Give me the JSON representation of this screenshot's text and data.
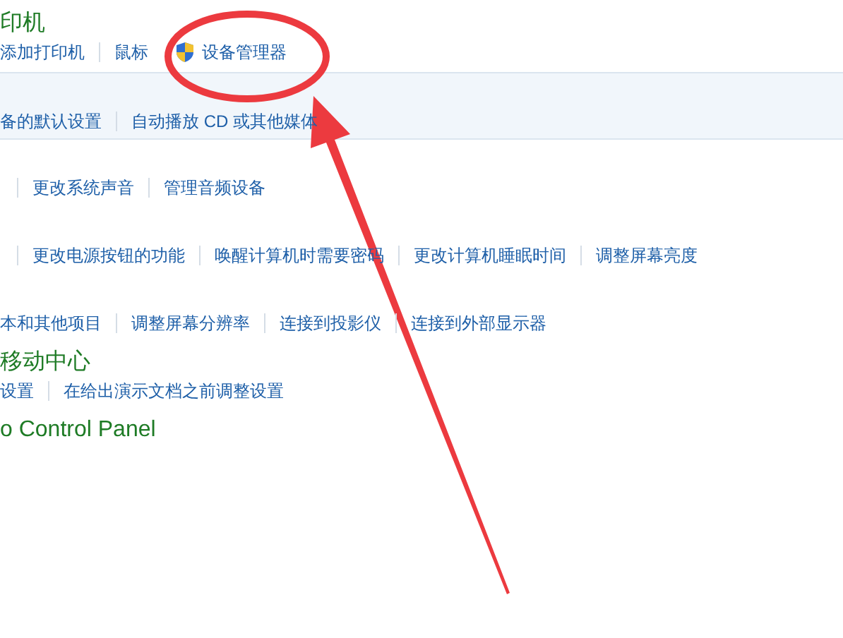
{
  "sections": [
    {
      "title": "印机",
      "highlighted": false,
      "leading_divider": false,
      "links": [
        {
          "label": "添加打印机",
          "shield": false
        },
        {
          "label": "鼠标",
          "shield": false
        },
        {
          "label": "设备管理器",
          "shield": true
        }
      ]
    },
    {
      "highlighted": true,
      "leading_divider": false,
      "links": [
        {
          "label": "备的默认设置",
          "shield": false
        },
        {
          "label": "自动播放 CD 或其他媒体",
          "shield": false
        }
      ]
    },
    {
      "highlighted": false,
      "leading_divider": true,
      "links": [
        {
          "label": "更改系统声音",
          "shield": false
        },
        {
          "label": "管理音频设备",
          "shield": false
        }
      ]
    },
    {
      "highlighted": false,
      "leading_divider": true,
      "links": [
        {
          "label": "更改电源按钮的功能",
          "shield": false
        },
        {
          "label": "唤醒计算机时需要密码",
          "shield": false
        },
        {
          "label": "更改计算机睡眠时间",
          "shield": false
        },
        {
          "label": "调整屏幕亮度",
          "shield": false
        }
      ]
    },
    {
      "highlighted": false,
      "leading_divider": false,
      "links": [
        {
          "label": "本和其他项目",
          "shield": false
        },
        {
          "label": "调整屏幕分辨率",
          "shield": false
        },
        {
          "label": "连接到投影仪",
          "shield": false
        },
        {
          "label": "连接到外部显示器",
          "shield": false
        }
      ]
    },
    {
      "title": "移动中心",
      "highlighted": false,
      "leading_divider": false,
      "links": [
        {
          "label": "设置",
          "shield": false
        },
        {
          "label": "在给出演示文档之前调整设置",
          "shield": false
        }
      ]
    },
    {
      "title": "o Control Panel",
      "highlighted": false
    }
  ]
}
